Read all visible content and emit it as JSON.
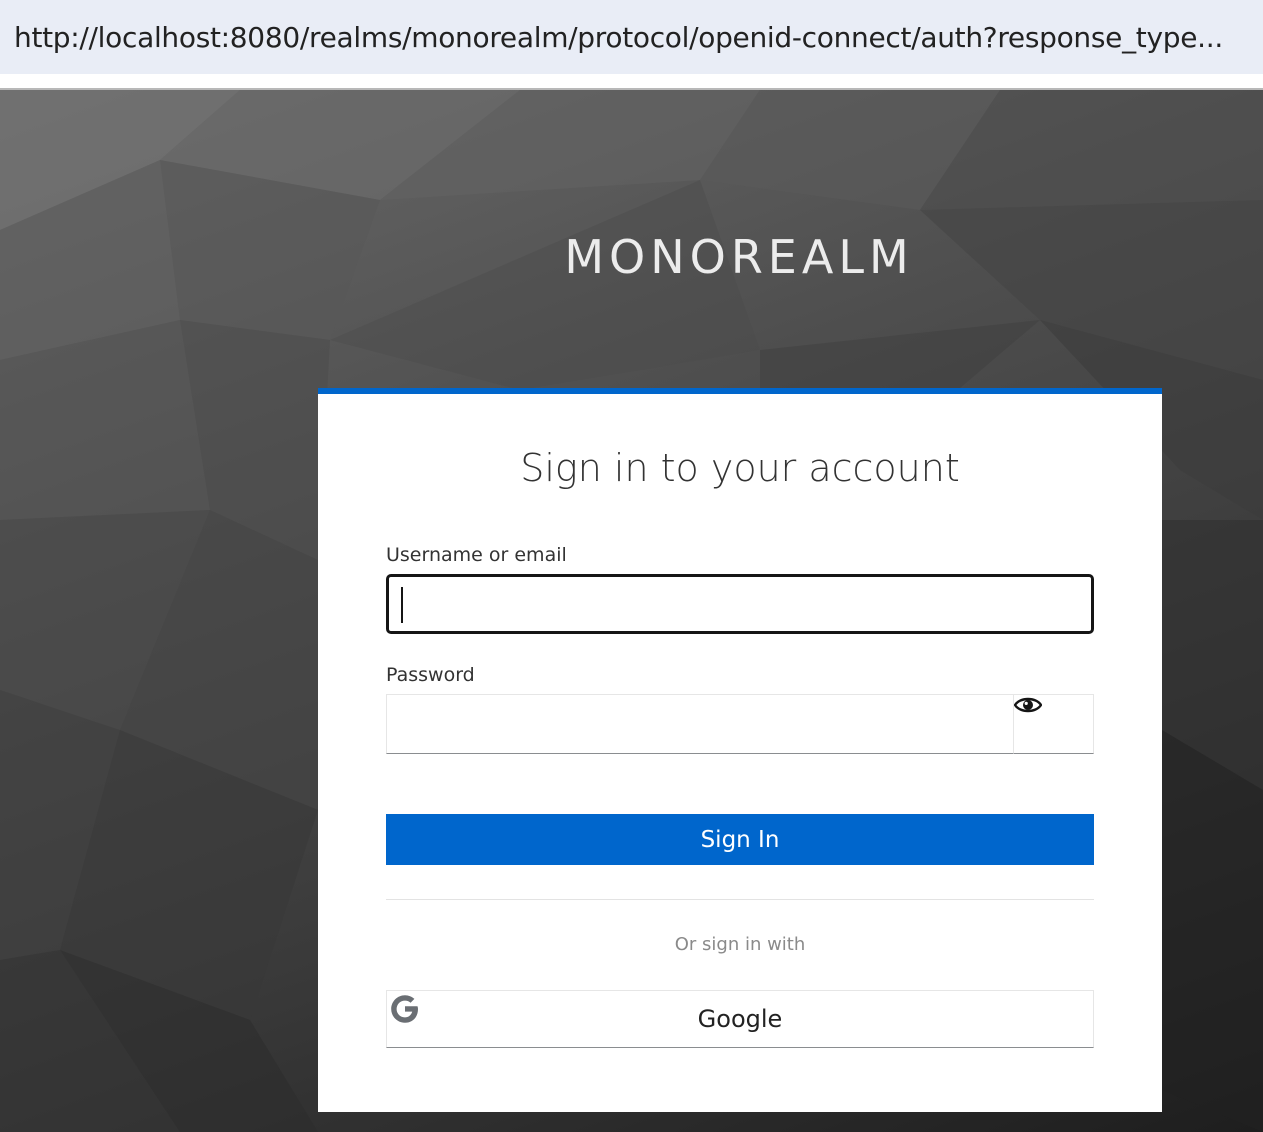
{
  "browser": {
    "url": "http://localhost:8080/realms/monorealm/protocol/openid-connect/auth?response_type..."
  },
  "realm": {
    "title": "MONOREALM"
  },
  "login": {
    "heading": "Sign in to your account",
    "username_label": "Username or email",
    "username_value": "",
    "password_label": "Password",
    "password_value": "",
    "show_password_icon": "eye-icon",
    "sign_in_label": "Sign In",
    "divider_text": "Or sign in with",
    "providers": [
      {
        "label": "Google",
        "icon": "google-icon"
      }
    ]
  },
  "colors": {
    "accent": "#0066cc",
    "url_bar_bg": "#e9edf6",
    "focused_border": "#151515"
  }
}
